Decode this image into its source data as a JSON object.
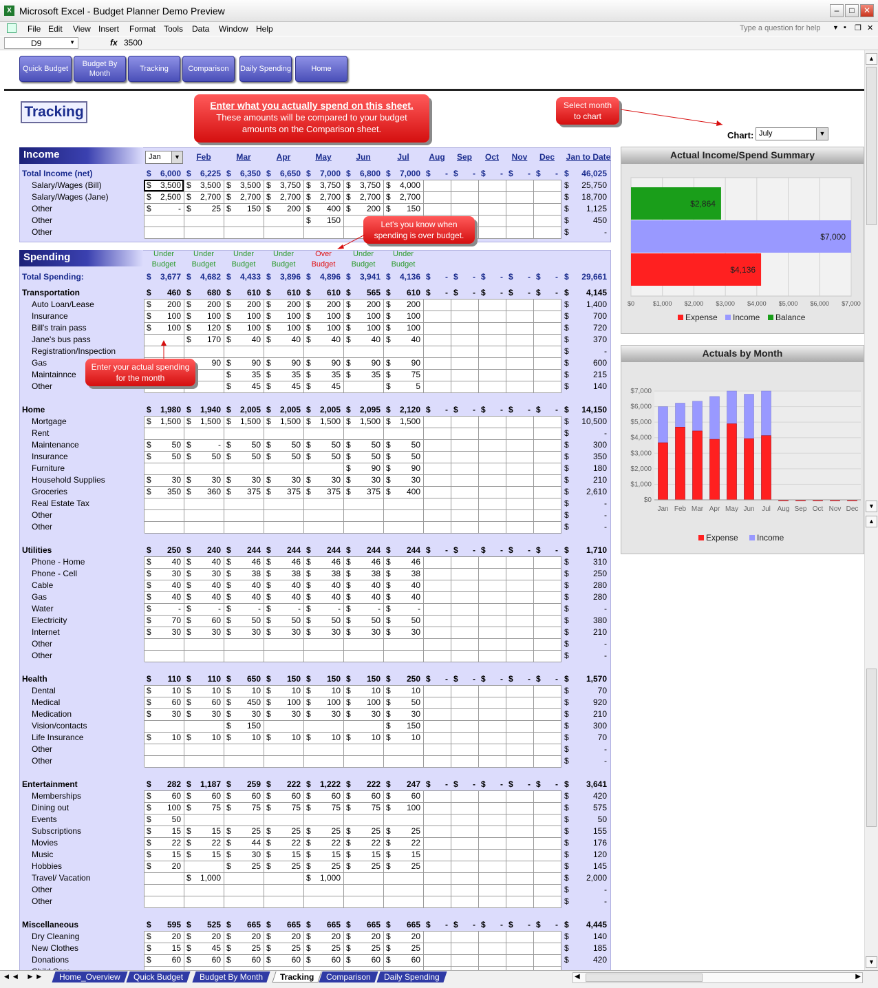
{
  "window": {
    "title": "Microsoft Excel - Budget Planner Demo Preview",
    "app_icon": "X",
    "min": "‒",
    "max": "□",
    "close": "✕"
  },
  "menu": {
    "items": [
      "File",
      "Edit",
      "View",
      "Insert",
      "Format",
      "Tools",
      "Data",
      "Window",
      "Help"
    ],
    "help_placeholder": "Type a question for help"
  },
  "formula_bar": {
    "cell": "D9",
    "fx": "fx",
    "value": "3500"
  },
  "nav_buttons": [
    "Quick Budget",
    "Budget By Month",
    "Tracking",
    "Comparison",
    "Daily Spending",
    "Home"
  ],
  "sheet_title": "Tracking",
  "callouts": {
    "main_title": "Enter what you actually spend on this sheet.",
    "main_body": "These amounts will be compared to your budget amounts on the Comparison sheet.",
    "select_month": "Select month to chart",
    "over_budget": "Let's you know when spending is over budget.",
    "enter_actual": "Enter your actual spending for the month"
  },
  "chart_selector": {
    "label": "Chart:",
    "value": "July"
  },
  "months": [
    "Feb",
    "Mar",
    "Apr",
    "May",
    "Jun",
    "Jul",
    "Aug",
    "Sep",
    "Oct",
    "Nov",
    "Dec"
  ],
  "month_dropdown": "Jan",
  "ytd_header": "Jan to Date",
  "income": {
    "header": "Income",
    "total_label": "Total Income (net)",
    "totals": [
      "$ 6,000",
      "$ 6,225",
      "$ 6,350",
      "$ 6,650",
      "$ 7,000",
      "$ 6,800",
      "$ 7,000",
      "$ -",
      "$ -",
      "$ -",
      "$ -",
      "$ -"
    ],
    "total_ytd": "$ 46,025",
    "rows": [
      {
        "label": "Salary/Wages (Bill)",
        "cells": [
          "$ 3,500",
          "$ 3,500",
          "$ 3,500",
          "$ 3,750",
          "$ 3,750",
          "$ 3,750",
          "$ 4,000",
          "",
          "",
          "",
          "",
          ""
        ],
        "ytd": "$ 25,750"
      },
      {
        "label": "Salary/Wages (Jane)",
        "cells": [
          "$ 2,500",
          "$ 2,700",
          "$ 2,700",
          "$ 2,700",
          "$ 2,700",
          "$ 2,700",
          "$ 2,700",
          "",
          "",
          "",
          "",
          ""
        ],
        "ytd": "$ 18,700"
      },
      {
        "label": "Other",
        "cells": [
          "$ -",
          "$ 25",
          "$ 150",
          "$ 200",
          "$ 400",
          "$ 200",
          "$ 150",
          "",
          "",
          "",
          "",
          ""
        ],
        "ytd": "$ 1,125"
      },
      {
        "label": "Other",
        "cells": [
          "",
          "",
          "",
          "",
          "$ 150",
          "$",
          "",
          "",
          "",
          "",
          "",
          ""
        ],
        "ytd": "$ 450"
      },
      {
        "label": "Other",
        "cells": [
          "",
          "",
          "",
          "",
          "",
          "",
          "",
          "",
          "",
          "",
          "",
          ""
        ],
        "ytd": "$ -"
      }
    ]
  },
  "spending": {
    "header": "Spending",
    "status": [
      "Under Budget",
      "Under Budget",
      "Under Budget",
      "Under Budget",
      "Over Budget",
      "Under Budget",
      "Under Budget"
    ],
    "total_label": "Total Spending:",
    "totals": [
      "$ 3,677",
      "$ 4,682",
      "$ 4,433",
      "$ 3,896",
      "$ 4,896",
      "$ 3,941",
      "$ 4,136",
      "$ -",
      "$ -",
      "$ -",
      "$ -",
      "$ -"
    ],
    "total_ytd": "$ 29,661"
  },
  "categories": [
    {
      "name": "Transportation",
      "totals": [
        "$ 460",
        "$ 680",
        "$ 610",
        "$ 610",
        "$ 610",
        "$ 565",
        "$ 610",
        "$ -",
        "$ -",
        "$ -",
        "$ -",
        "$ -"
      ],
      "ytd": "$ 4,145",
      "rows": [
        {
          "label": "Auto Loan/Lease",
          "cells": [
            "$ 200",
            "$ 200",
            "$ 200",
            "$ 200",
            "$ 200",
            "$ 200",
            "$ 200"
          ],
          "ytd": "$ 1,400"
        },
        {
          "label": "Insurance",
          "cells": [
            "$ 100",
            "$ 100",
            "$ 100",
            "$ 100",
            "$ 100",
            "$ 100",
            "$ 100"
          ],
          "ytd": "$ 700"
        },
        {
          "label": "Bill's train pass",
          "cells": [
            "$ 100",
            "$ 120",
            "$ 100",
            "$ 100",
            "$ 100",
            "$ 100",
            "$ 100"
          ],
          "ytd": "$ 720"
        },
        {
          "label": "Jane's bus pass",
          "cells": [
            "",
            "$ 170",
            "$ 40",
            "$ 40",
            "$ 40",
            "$ 40",
            "$ 40"
          ],
          "ytd": "$ 370"
        },
        {
          "label": "Registration/Inspection",
          "cells": [
            "",
            "",
            "",
            "",
            "",
            "",
            ""
          ],
          "ytd": "$ -"
        },
        {
          "label": "Gas",
          "cells": [
            "",
            "90",
            "$ 90",
            "$ 90",
            "$ 90",
            "$ 90",
            "$ 90"
          ],
          "ytd": "$ 600"
        },
        {
          "label": "Maintainnce",
          "cells": [
            "",
            "",
            "$ 35",
            "$ 35",
            "$ 35",
            "$ 35",
            "$ 75"
          ],
          "ytd": "$ 215"
        },
        {
          "label": "Other",
          "cells": [
            "",
            "",
            "$ 45",
            "$ 45",
            "$ 45",
            "",
            "$ 5"
          ],
          "ytd": "$ 140"
        }
      ]
    },
    {
      "name": "Home",
      "totals": [
        "$ 1,980",
        "$ 1,940",
        "$ 2,005",
        "$ 2,005",
        "$ 2,005",
        "$ 2,095",
        "$ 2,120",
        "$ -",
        "$ -",
        "$ -",
        "$ -",
        "$ -"
      ],
      "ytd": "$ 14,150",
      "rows": [
        {
          "label": "Mortgage",
          "cells": [
            "$ 1,500",
            "$ 1,500",
            "$ 1,500",
            "$ 1,500",
            "$ 1,500",
            "$ 1,500",
            "$ 1,500"
          ],
          "ytd": "$ 10,500"
        },
        {
          "label": "Rent",
          "cells": [
            "",
            "",
            "",
            "",
            "",
            "",
            ""
          ],
          "ytd": "$ -"
        },
        {
          "label": "Maintenance",
          "cells": [
            "$ 50",
            "$ -",
            "$ 50",
            "$ 50",
            "$ 50",
            "$ 50",
            "$ 50"
          ],
          "ytd": "$ 300"
        },
        {
          "label": "Insurance",
          "cells": [
            "$ 50",
            "$ 50",
            "$ 50",
            "$ 50",
            "$ 50",
            "$ 50",
            "$ 50"
          ],
          "ytd": "$ 350"
        },
        {
          "label": "Furniture",
          "cells": [
            "",
            "",
            "",
            "",
            "",
            "$ 90",
            "$ 90"
          ],
          "ytd": "$ 180"
        },
        {
          "label": "Household Supplies",
          "cells": [
            "$ 30",
            "$ 30",
            "$ 30",
            "$ 30",
            "$ 30",
            "$ 30",
            "$ 30"
          ],
          "ytd": "$ 210"
        },
        {
          "label": "Groceries",
          "cells": [
            "$ 350",
            "$ 360",
            "$ 375",
            "$ 375",
            "$ 375",
            "$ 375",
            "$ 400"
          ],
          "ytd": "$ 2,610"
        },
        {
          "label": "Real Estate Tax",
          "cells": [
            "",
            "",
            "",
            "",
            "",
            "",
            ""
          ],
          "ytd": "$ -"
        },
        {
          "label": "Other",
          "cells": [
            "",
            "",
            "",
            "",
            "",
            "",
            ""
          ],
          "ytd": "$ -"
        },
        {
          "label": "Other",
          "cells": [
            "",
            "",
            "",
            "",
            "",
            "",
            ""
          ],
          "ytd": "$ -"
        }
      ]
    },
    {
      "name": "Utilities",
      "totals": [
        "$ 250",
        "$ 240",
        "$ 244",
        "$ 244",
        "$ 244",
        "$ 244",
        "$ 244",
        "$ -",
        "$ -",
        "$ -",
        "$ -",
        "$ -"
      ],
      "ytd": "$ 1,710",
      "rows": [
        {
          "label": "Phone - Home",
          "cells": [
            "$ 40",
            "$ 40",
            "$ 46",
            "$ 46",
            "$ 46",
            "$ 46",
            "$ 46"
          ],
          "ytd": "$ 310"
        },
        {
          "label": "Phone - Cell",
          "cells": [
            "$ 30",
            "$ 30",
            "$ 38",
            "$ 38",
            "$ 38",
            "$ 38",
            "$ 38"
          ],
          "ytd": "$ 250"
        },
        {
          "label": "Cable",
          "cells": [
            "$ 40",
            "$ 40",
            "$ 40",
            "$ 40",
            "$ 40",
            "$ 40",
            "$ 40"
          ],
          "ytd": "$ 280"
        },
        {
          "label": "Gas",
          "cells": [
            "$ 40",
            "$ 40",
            "$ 40",
            "$ 40",
            "$ 40",
            "$ 40",
            "$ 40"
          ],
          "ytd": "$ 280"
        },
        {
          "label": "Water",
          "cells": [
            "$ -",
            "$ -",
            "$ -",
            "$ -",
            "$ -",
            "$ -",
            "$ -"
          ],
          "ytd": "$ -"
        },
        {
          "label": "Electricity",
          "cells": [
            "$ 70",
            "$ 60",
            "$ 50",
            "$ 50",
            "$ 50",
            "$ 50",
            "$ 50"
          ],
          "ytd": "$ 380"
        },
        {
          "label": "Internet",
          "cells": [
            "$ 30",
            "$ 30",
            "$ 30",
            "$ 30",
            "$ 30",
            "$ 30",
            "$ 30"
          ],
          "ytd": "$ 210"
        },
        {
          "label": "Other",
          "cells": [
            "",
            "",
            "",
            "",
            "",
            "",
            ""
          ],
          "ytd": "$ -"
        },
        {
          "label": "Other",
          "cells": [
            "",
            "",
            "",
            "",
            "",
            "",
            ""
          ],
          "ytd": "$ -"
        }
      ]
    },
    {
      "name": "Health",
      "totals": [
        "$ 110",
        "$ 110",
        "$ 650",
        "$ 150",
        "$ 150",
        "$ 150",
        "$ 250",
        "$ -",
        "$ -",
        "$ -",
        "$ -",
        "$ -"
      ],
      "ytd": "$ 1,570",
      "rows": [
        {
          "label": "Dental",
          "cells": [
            "$ 10",
            "$ 10",
            "$ 10",
            "$ 10",
            "$ 10",
            "$ 10",
            "$ 10"
          ],
          "ytd": "$ 70"
        },
        {
          "label": "Medical",
          "cells": [
            "$ 60",
            "$ 60",
            "$ 450",
            "$ 100",
            "$ 100",
            "$ 100",
            "$ 50"
          ],
          "ytd": "$ 920"
        },
        {
          "label": "Medication",
          "cells": [
            "$ 30",
            "$ 30",
            "$ 30",
            "$ 30",
            "$ 30",
            "$ 30",
            "$ 30"
          ],
          "ytd": "$ 210"
        },
        {
          "label": "Vision/contacts",
          "cells": [
            "",
            "",
            "$ 150",
            "",
            "",
            "",
            "$ 150"
          ],
          "ytd": "$ 300"
        },
        {
          "label": "Life Insurance",
          "cells": [
            "$ 10",
            "$ 10",
            "$ 10",
            "$ 10",
            "$ 10",
            "$ 10",
            "$ 10"
          ],
          "ytd": "$ 70"
        },
        {
          "label": "Other",
          "cells": [
            "",
            "",
            "",
            "",
            "",
            "",
            ""
          ],
          "ytd": "$ -"
        },
        {
          "label": "Other",
          "cells": [
            "",
            "",
            "",
            "",
            "",
            "",
            ""
          ],
          "ytd": "$ -"
        }
      ]
    },
    {
      "name": "Entertainment",
      "totals": [
        "$ 282",
        "$ 1,187",
        "$ 259",
        "$ 222",
        "$ 1,222",
        "$ 222",
        "$ 247",
        "$ -",
        "$ -",
        "$ -",
        "$ -",
        "$ -"
      ],
      "ytd": "$ 3,641",
      "rows": [
        {
          "label": "Memberships",
          "cells": [
            "$ 60",
            "$ 60",
            "$ 60",
            "$ 60",
            "$ 60",
            "$ 60",
            "$ 60"
          ],
          "ytd": "$ 420"
        },
        {
          "label": "Dining out",
          "cells": [
            "$ 100",
            "$ 75",
            "$ 75",
            "$ 75",
            "$ 75",
            "$ 75",
            "$ 100"
          ],
          "ytd": "$ 575"
        },
        {
          "label": "Events",
          "cells": [
            "$ 50",
            "",
            "",
            "",
            "",
            "",
            ""
          ],
          "ytd": "$ 50"
        },
        {
          "label": "Subscriptions",
          "cells": [
            "$ 15",
            "$ 15",
            "$ 25",
            "$ 25",
            "$ 25",
            "$ 25",
            "$ 25"
          ],
          "ytd": "$ 155"
        },
        {
          "label": "Movies",
          "cells": [
            "$ 22",
            "$ 22",
            "$ 44",
            "$ 22",
            "$ 22",
            "$ 22",
            "$ 22"
          ],
          "ytd": "$ 176"
        },
        {
          "label": "Music",
          "cells": [
            "$ 15",
            "$ 15",
            "$ 30",
            "$ 15",
            "$ 15",
            "$ 15",
            "$ 15"
          ],
          "ytd": "$ 120"
        },
        {
          "label": "Hobbies",
          "cells": [
            "$ 20",
            "",
            "$ 25",
            "$ 25",
            "$ 25",
            "$ 25",
            "$ 25"
          ],
          "ytd": "$ 145"
        },
        {
          "label": "Travel/ Vacation",
          "cells": [
            "",
            "$ 1,000",
            "",
            "",
            "$ 1,000",
            "",
            ""
          ],
          "ytd": "$ 2,000"
        },
        {
          "label": "Other",
          "cells": [
            "",
            "",
            "",
            "",
            "",
            "",
            ""
          ],
          "ytd": "$ -"
        },
        {
          "label": "Other",
          "cells": [
            "",
            "",
            "",
            "",
            "",
            "",
            ""
          ],
          "ytd": "$ -"
        }
      ]
    },
    {
      "name": "Miscellaneous",
      "totals": [
        "$ 595",
        "$ 525",
        "$ 665",
        "$ 665",
        "$ 665",
        "$ 665",
        "$ 665",
        "$ -",
        "$ -",
        "$ -",
        "$ -",
        "$ -"
      ],
      "ytd": "$ 4,445",
      "rows": [
        {
          "label": "Dry Cleaning",
          "cells": [
            "$ 20",
            "$ 20",
            "$ 20",
            "$ 20",
            "$ 20",
            "$ 20",
            "$ 20"
          ],
          "ytd": "$ 140"
        },
        {
          "label": "New Clothes",
          "cells": [
            "$ 15",
            "$ 45",
            "$ 25",
            "$ 25",
            "$ 25",
            "$ 25",
            "$ 25"
          ],
          "ytd": "$ 185"
        },
        {
          "label": "Donations",
          "cells": [
            "$ 60",
            "$ 60",
            "$ 60",
            "$ 60",
            "$ 60",
            "$ 60",
            "$ 60"
          ],
          "ytd": "$ 420"
        },
        {
          "label": "Child Care",
          "cells": [
            "",
            "",
            "",
            "",
            "",
            "",
            ""
          ],
          "ytd": ""
        }
      ]
    }
  ],
  "chart_data": [
    {
      "type": "bar",
      "title": "Actual Income/Spend Summary",
      "orientation": "horizontal",
      "categories": [
        "Balance",
        "Income",
        "Expense"
      ],
      "values": [
        2864,
        7000,
        4136
      ],
      "data_labels": [
        "$2,864",
        "$7,000",
        "$4,136"
      ],
      "xlim": [
        0,
        7000
      ],
      "xticks": [
        "$0",
        "$1,000",
        "$2,000",
        "$3,000",
        "$4,000",
        "$5,000",
        "$6,000",
        "$7,000"
      ],
      "legend": [
        "Expense",
        "Income",
        "Balance"
      ],
      "legend_position": "bottom",
      "colors": {
        "Expense": "#ff2020",
        "Income": "#9999ff",
        "Balance": "#1a9e1a"
      },
      "grid": true
    },
    {
      "type": "bar",
      "title": "Actuals by Month",
      "stacked": false,
      "categories": [
        "Jan",
        "Feb",
        "Mar",
        "Apr",
        "May",
        "Jun",
        "Jul",
        "Aug",
        "Sep",
        "Oct",
        "Nov",
        "Dec"
      ],
      "series": [
        {
          "name": "Expense",
          "values": [
            3677,
            4682,
            4433,
            3896,
            4896,
            3941,
            4136,
            0,
            0,
            0,
            0,
            0
          ]
        },
        {
          "name": "Income",
          "values": [
            6000,
            6225,
            6350,
            6650,
            7000,
            6800,
            7000,
            0,
            0,
            0,
            0,
            0
          ]
        }
      ],
      "ylim": [
        0,
        7000
      ],
      "yticks": [
        "$0",
        "$1,000",
        "$2,000",
        "$3,000",
        "$4,000",
        "$5,000",
        "$6,000",
        "$7,000"
      ],
      "legend_position": "bottom",
      "colors": {
        "Expense": "#ff2020",
        "Income": "#9999ff"
      },
      "grid": true
    }
  ],
  "sheet_tabs": [
    "Home_Overview",
    "Quick Budget",
    "Budget By Month",
    "Tracking",
    "Comparison",
    "Daily Spending"
  ],
  "active_tab": "Tracking"
}
